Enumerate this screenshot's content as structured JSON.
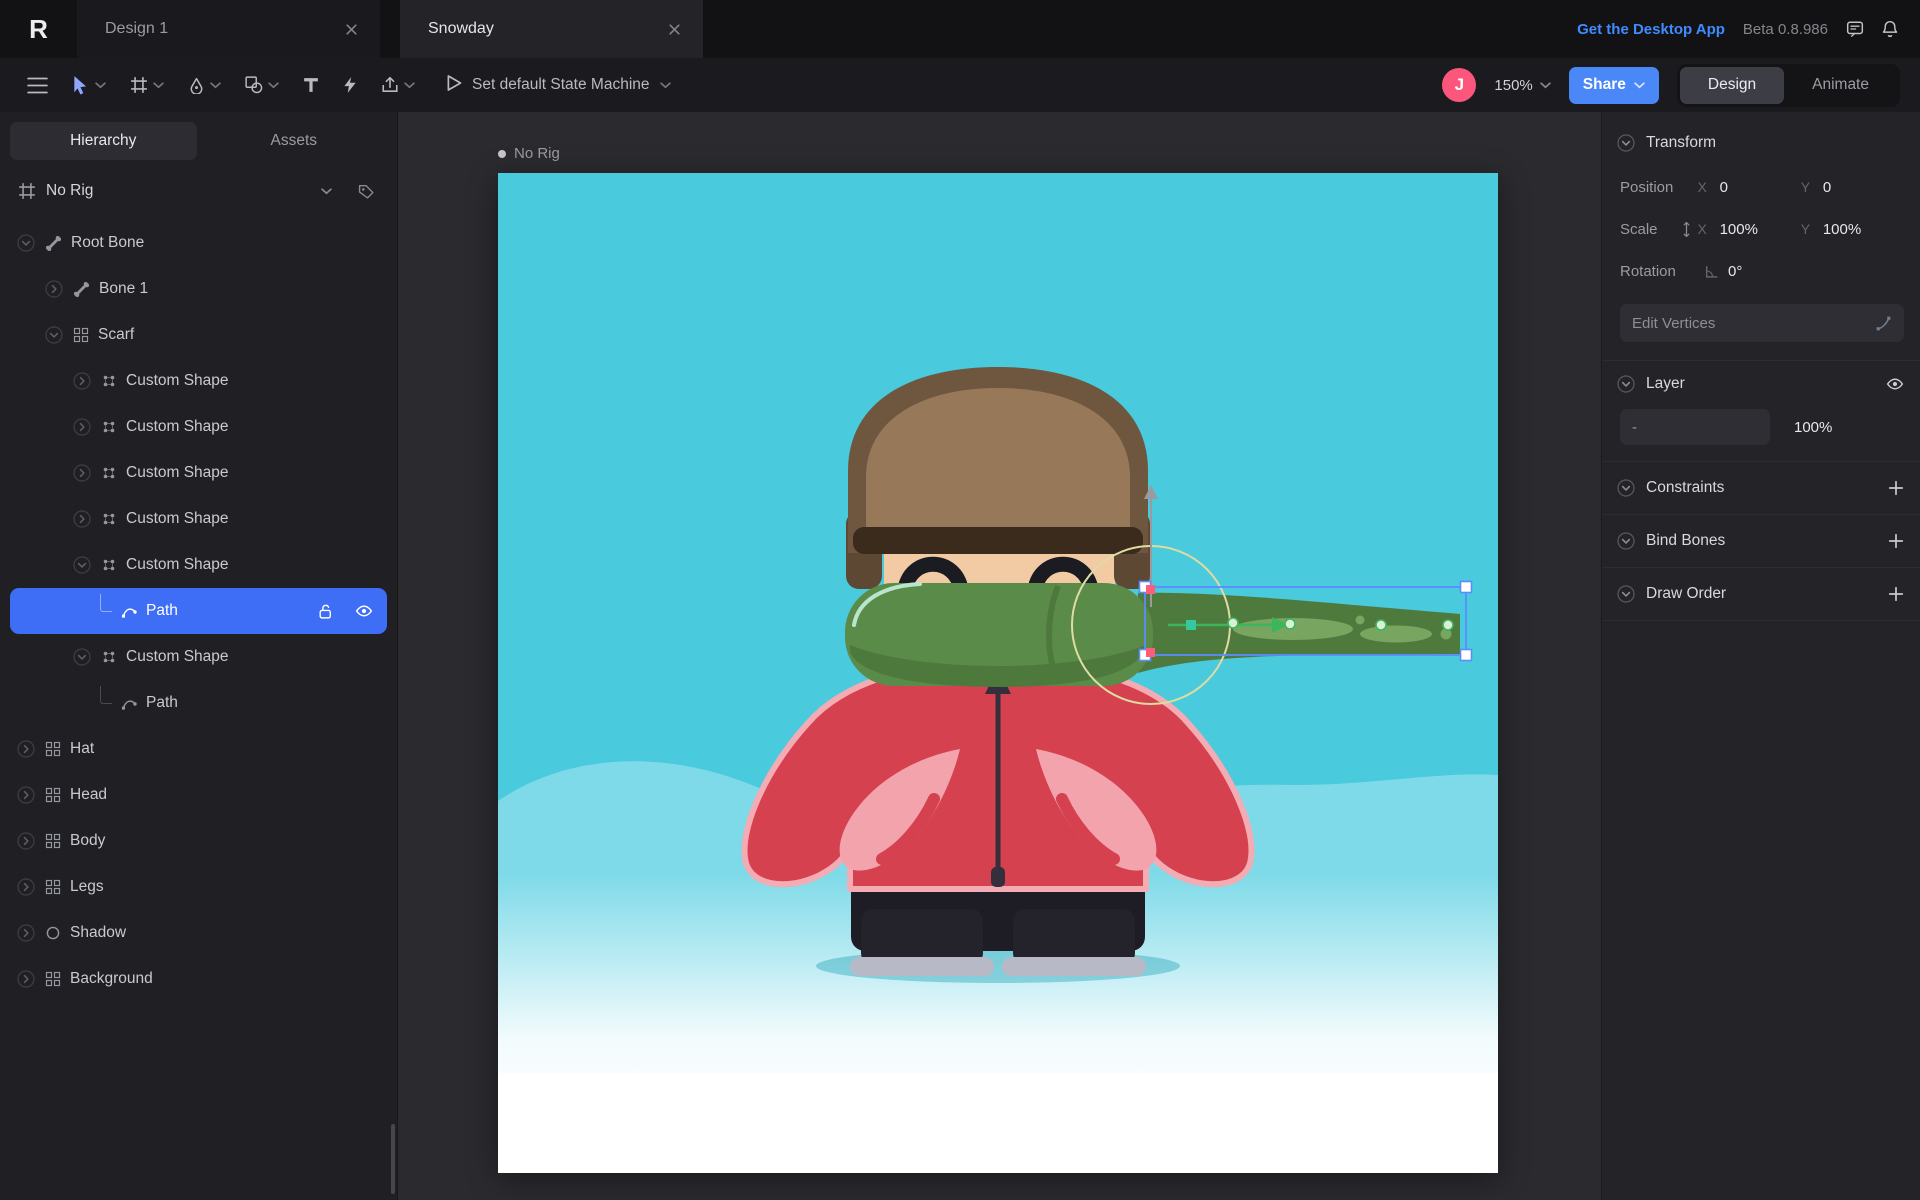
{
  "app": {
    "name": "Rive"
  },
  "colors": {
    "selection_blue": "#3e6ef5",
    "share_blue": "#4a87f7",
    "avatar_pink": "#fd567d",
    "link_blue": "#3f8cff",
    "sky_turquoise": "#49cadd",
    "scarf_green": "#5b8b48",
    "coat_red": "#d6414f"
  },
  "tabbar": {
    "tabs": [
      {
        "label": "Design 1",
        "active": false
      },
      {
        "label": "Snowday",
        "active": true
      }
    ],
    "desktop_app_link": "Get the Desktop App",
    "beta_version": "Beta 0.8.986",
    "icons": [
      "feedback",
      "bell"
    ]
  },
  "toolbar": {
    "tools": [
      {
        "icon": "menu",
        "caret": false,
        "active": false
      },
      {
        "icon": "cursor",
        "caret": true,
        "active": true
      },
      {
        "icon": "artboard",
        "caret": true,
        "active": false
      },
      {
        "icon": "pen",
        "caret": true,
        "active": false
      },
      {
        "icon": "shapes",
        "caret": true,
        "active": false
      },
      {
        "icon": "text",
        "caret": false,
        "active": false
      },
      {
        "icon": "bolt",
        "caret": false,
        "active": false
      },
      {
        "icon": "export",
        "caret": true,
        "active": false
      }
    ],
    "state_machine_label": "Set default State Machine",
    "avatar_initial": "J",
    "zoom_level": "150%",
    "share_label": "Share",
    "mode_design": "Design",
    "mode_animate": "Animate"
  },
  "sidebar": {
    "tabs": [
      {
        "label": "Hierarchy",
        "active": true
      },
      {
        "label": "Assets",
        "active": false
      }
    ],
    "rig_selector_label": "No Rig",
    "tree": [
      {
        "label": "Root Bone",
        "icon": "bone",
        "depth": 0,
        "chevron": "down"
      },
      {
        "label": "Bone 1",
        "icon": "bone",
        "depth": 1,
        "chevron": "right"
      },
      {
        "label": "Scarf",
        "icon": "group",
        "depth": 1,
        "chevron": "down"
      },
      {
        "label": "Custom Shape",
        "icon": "custom-shape",
        "depth": 2,
        "chevron": "right"
      },
      {
        "label": "Custom Shape",
        "icon": "custom-shape",
        "depth": 2,
        "chevron": "right"
      },
      {
        "label": "Custom Shape",
        "icon": "custom-shape",
        "depth": 2,
        "chevron": "right"
      },
      {
        "label": "Custom Shape",
        "icon": "custom-shape",
        "depth": 2,
        "chevron": "right"
      },
      {
        "label": "Custom Shape",
        "icon": "custom-shape",
        "depth": 2,
        "chevron": "down"
      },
      {
        "label": "Path",
        "icon": "path",
        "depth": 3,
        "chevron": "none",
        "selected": true,
        "trailing_icons": [
          "unlock",
          "eye"
        ]
      },
      {
        "label": "Custom Shape",
        "icon": "custom-shape",
        "depth": 2,
        "chevron": "down"
      },
      {
        "label": "Path",
        "icon": "path",
        "depth": 3,
        "chevron": "none"
      },
      {
        "label": "Hat",
        "icon": "group",
        "depth": 0,
        "chevron": "right"
      },
      {
        "label": "Head",
        "icon": "group",
        "depth": 0,
        "chevron": "right"
      },
      {
        "label": "Body",
        "icon": "group",
        "depth": 0,
        "chevron": "right"
      },
      {
        "label": "Legs",
        "icon": "group",
        "depth": 0,
        "chevron": "right"
      },
      {
        "label": "Shadow",
        "icon": "ellipse",
        "depth": 0,
        "chevron": "right"
      },
      {
        "label": "Background",
        "icon": "group",
        "depth": 0,
        "chevron": "right"
      }
    ]
  },
  "canvas": {
    "rig_badge": "No Rig"
  },
  "inspector": {
    "transform": {
      "title": "Transform",
      "position_label": "Position",
      "x_label": "X",
      "y_label": "Y",
      "position_x": "0",
      "position_y": "0",
      "scale_label": "Scale",
      "scale_x": "100%",
      "scale_y": "100%",
      "rotation_label": "Rotation",
      "rotation_value": "0°",
      "edit_vertices_label": "Edit Vertices"
    },
    "layer": {
      "title": "Layer",
      "blend_value": "-",
      "opacity": "100%"
    },
    "collapsed_sections": [
      {
        "title": "Constraints"
      },
      {
        "title": "Bind Bones"
      },
      {
        "title": "Draw Order"
      }
    ]
  }
}
